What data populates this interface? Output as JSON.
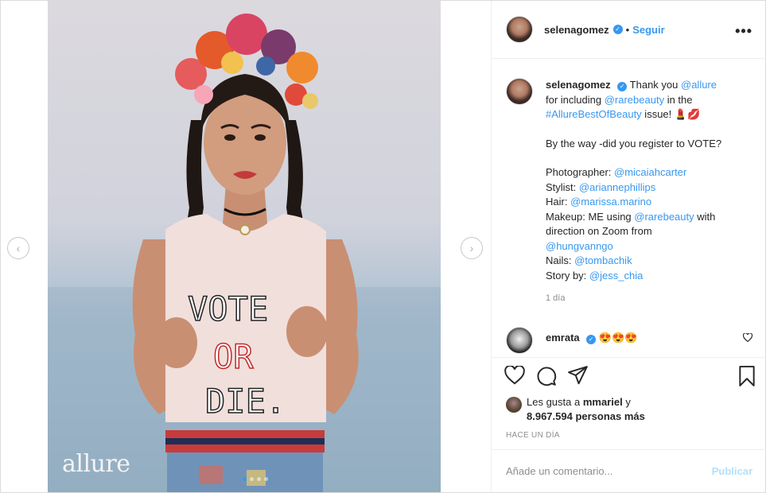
{
  "post": {
    "brand_watermark": "allure",
    "carousel": {
      "count": 4,
      "active": 1
    }
  },
  "header": {
    "username": "selenagomez",
    "bullet": "•",
    "follow_label": "Seguir",
    "more_label": "•••"
  },
  "caption": {
    "username": "selenagomez",
    "line1_a": "Thank you ",
    "mention_allure": "@allure",
    "line2_a": "for including ",
    "mention_rarebeauty": "@rarebeauty",
    "line2_b": " in the",
    "hashtag": "#AllureBestOfBeauty",
    "line3_b": " issue! 💄💋",
    "vote_line": "By the way -did you register to VOTE?",
    "photographer_label": "Photographer: ",
    "photographer": "@micaiahcarter",
    "stylist_label": "Stylist: ",
    "stylist": "@ariannephillips",
    "hair_label": "Hair: ",
    "hair": "@marissa.marino",
    "makeup_label": "Makeup: ME using ",
    "makeup": "@rarebeauty",
    "makeup_tail": " with",
    "direction_line": "direction on Zoom from",
    "direction": "@hungvanngo",
    "nails_label": "Nails: ",
    "nails": "@tombachik",
    "story_label": "Story by: ",
    "story": "@jess_chia",
    "time": "1 día"
  },
  "comment": {
    "username": "emrata",
    "text": "😍😍😍"
  },
  "likes": {
    "prefix": "Les gusta a ",
    "user": "mmariel",
    "y": " y",
    "count": "8.967.594",
    "suffix": " personas más"
  },
  "posted_ago": "HACE UN DÍA",
  "comment_box": {
    "placeholder": "Añade un comentario...",
    "publish_label": "Publicar"
  },
  "icons": {
    "prev": "chevron-left-icon",
    "next": "chevron-right-icon",
    "like": "heart-icon",
    "comment": "comment-icon",
    "share": "send-icon",
    "save": "bookmark-icon",
    "verified": "verified-badge-icon",
    "more": "more-options-icon"
  },
  "colors": {
    "link_blue": "#3897f0",
    "publish_disabled": "#b2dffc"
  }
}
